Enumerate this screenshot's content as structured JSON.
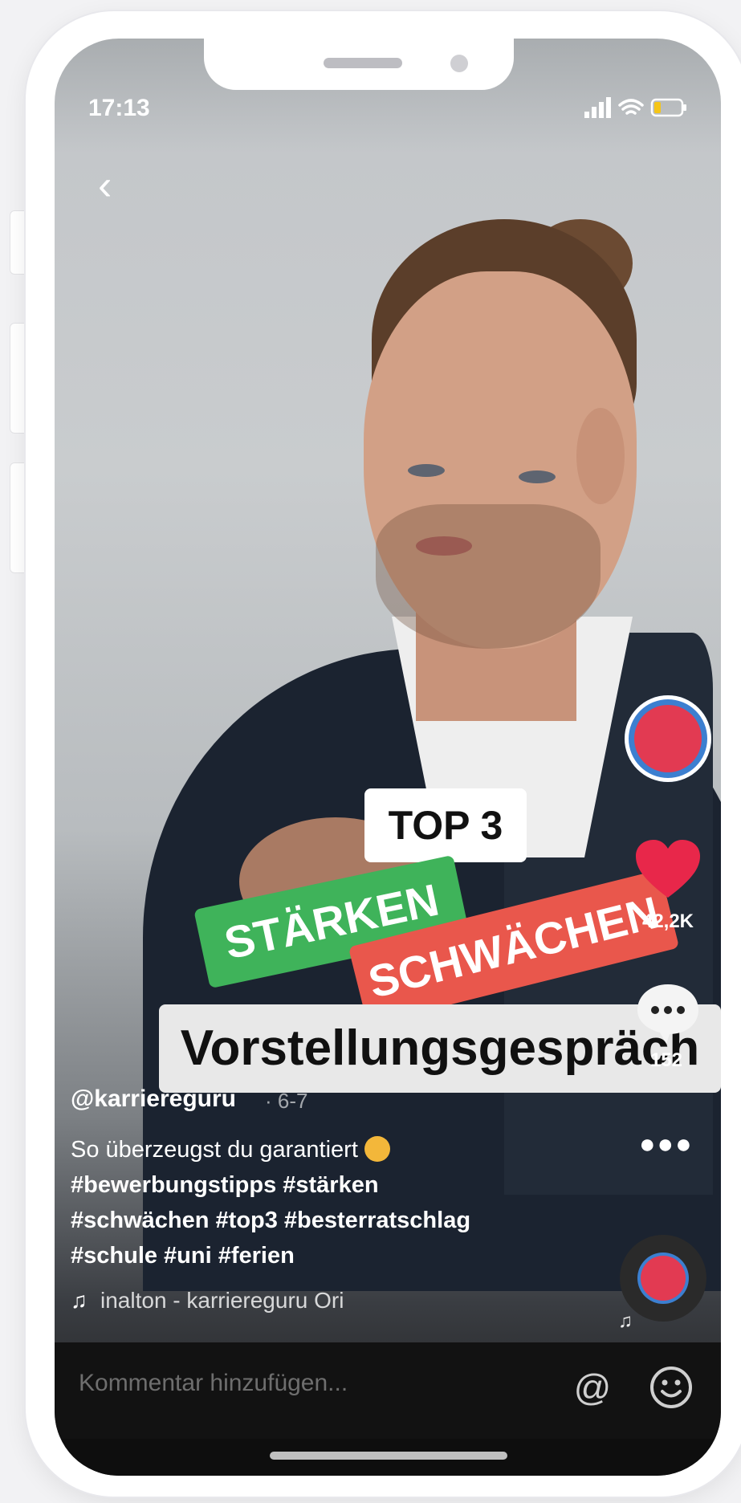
{
  "status_bar": {
    "time": "17:13"
  },
  "video": {
    "stickers": {
      "top3": "TOP 3",
      "strengths": "STÄRKEN",
      "weaknesses": "SCHWÄCHEN",
      "title": "Vorstellungsgespräch"
    }
  },
  "actions": {
    "likes": "42,2K",
    "comments": "152"
  },
  "post": {
    "username": "@karriereguru",
    "date": "· 6-7",
    "caption_text": "So überzeugst du garantiert",
    "hashtags_line1": "#bewerbungstipps #stärken",
    "hashtags_line2": "#schwächen #top3 #besterratschlag",
    "hashtags_line3": "#schule #uni #ferien",
    "music": "inalton - karriereguru   Ori"
  },
  "comment_bar": {
    "placeholder": "Kommentar hinzufügen..."
  },
  "icons": {
    "back": "back-icon",
    "heart": "heart-icon",
    "comment": "comment-icon",
    "more": "more-icon",
    "music": "music-note-icon",
    "mention": "at-icon",
    "emoji": "emoji-icon"
  },
  "colors": {
    "like": "#e8274a",
    "strengths_bg": "#3fb35a",
    "weaknesses_bg": "#e9574c"
  }
}
